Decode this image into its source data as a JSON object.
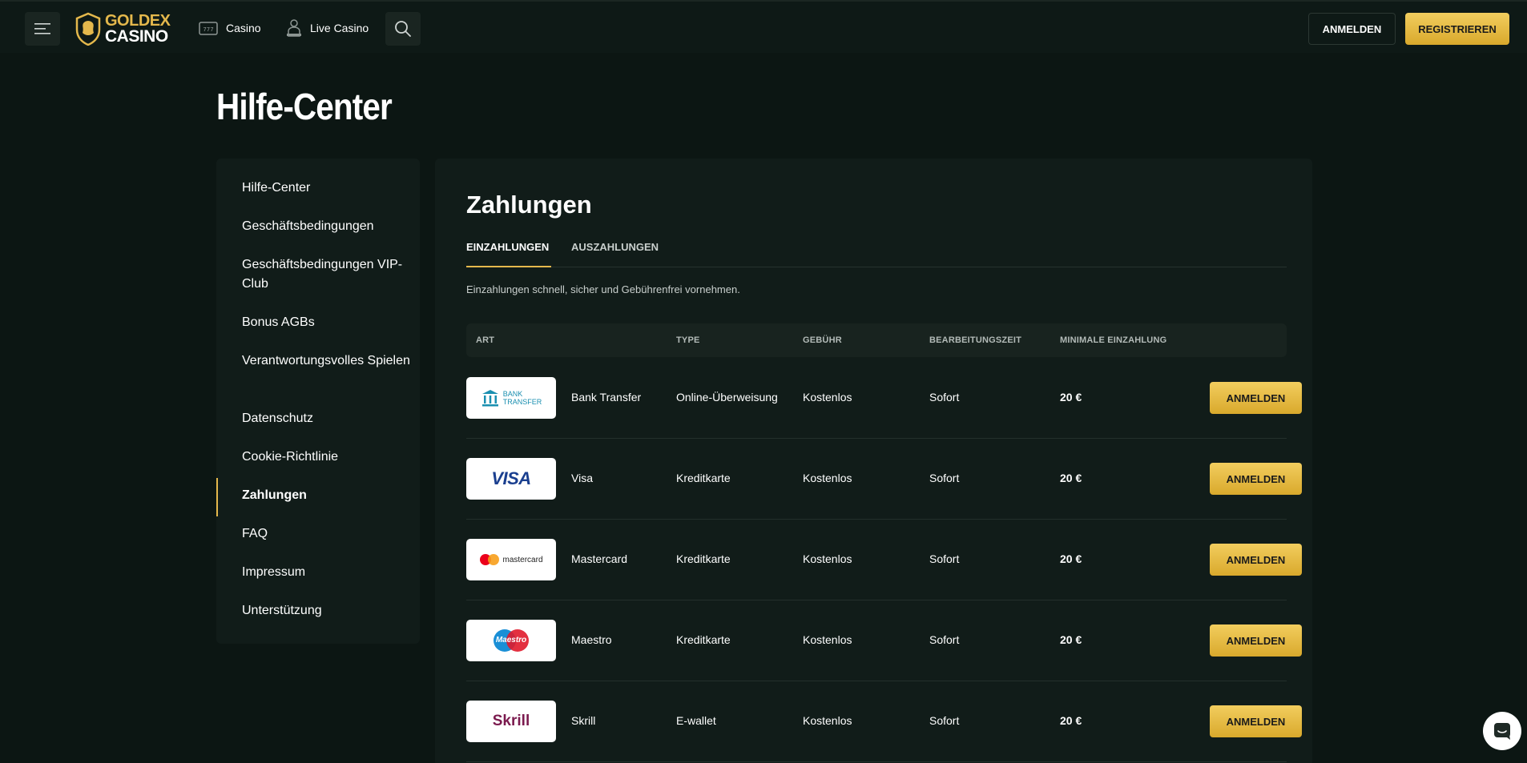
{
  "header": {
    "logo": {
      "line1": "GOLDEX",
      "line2": "CASINO"
    },
    "nav": [
      {
        "label": "Casino",
        "icon": "slot-machine-icon"
      },
      {
        "label": "Live Casino",
        "icon": "dealer-icon"
      }
    ],
    "login_label": "ANMELDEN",
    "register_label": "REGISTRIEREN"
  },
  "page_title": "Hilfe-Center",
  "sidebar": {
    "items": [
      {
        "label": "Hilfe-Center"
      },
      {
        "label": "Geschäftsbedingungen"
      },
      {
        "label": "Geschäftsbedingungen VIP-Club"
      },
      {
        "label": "Bonus AGBs"
      },
      {
        "label": "Verantwortungsvolles Spielen"
      },
      {
        "label": "Datenschutz"
      },
      {
        "label": "Cookie-Richtlinie"
      },
      {
        "label": "Zahlungen",
        "active": true
      },
      {
        "label": "FAQ"
      },
      {
        "label": "Impressum"
      },
      {
        "label": "Unterstützung"
      }
    ]
  },
  "main": {
    "title": "Zahlungen",
    "tabs": [
      {
        "label": "EINZAHLUNGEN",
        "active": true
      },
      {
        "label": "AUSZAHLUNGEN"
      }
    ],
    "description": "Einzahlungen schnell, sicher und Gebührenfrei vornehmen.",
    "columns": [
      "ART",
      "TYPE",
      "GEBÜHR",
      "BEARBEITUNGSZEIT",
      "MINIMALE EINZAHLUNG"
    ],
    "rows": [
      {
        "name": "Bank Transfer",
        "type": "Online-Überweisung",
        "fee": "Kostenlos",
        "time": "Sofort",
        "min": "20 €",
        "button": "ANMELDEN",
        "logo_line1": "BANK",
        "logo_line2": "TRANSFER"
      },
      {
        "name": "Visa",
        "type": "Kreditkarte",
        "fee": "Kostenlos",
        "time": "Sofort",
        "min": "20 €",
        "button": "ANMELDEN",
        "logo_text": "VISA"
      },
      {
        "name": "Mastercard",
        "type": "Kreditkarte",
        "fee": "Kostenlos",
        "time": "Sofort",
        "min": "20 €",
        "button": "ANMELDEN",
        "logo_text": "mastercard"
      },
      {
        "name": "Maestro",
        "type": "Kreditkarte",
        "fee": "Kostenlos",
        "time": "Sofort",
        "min": "20 €",
        "button": "ANMELDEN",
        "logo_text": "Maestro"
      },
      {
        "name": "Skrill",
        "type": "E-wallet",
        "fee": "Kostenlos",
        "time": "Sofort",
        "min": "20 €",
        "button": "ANMELDEN",
        "logo_text": "Skrill"
      }
    ]
  },
  "colors": {
    "background": "#0c1613",
    "panel": "#111c19",
    "accent_gold": "#e4b84c"
  }
}
